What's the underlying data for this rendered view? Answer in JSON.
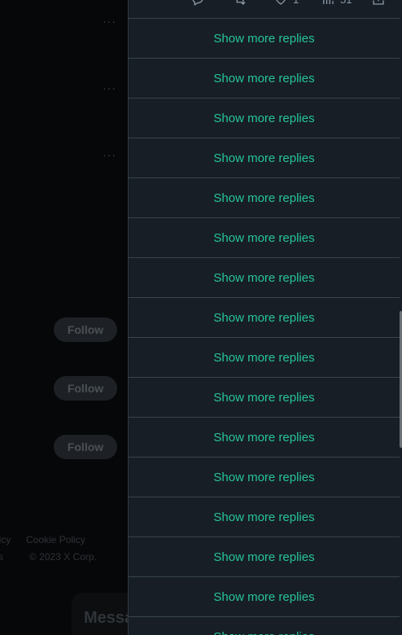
{
  "background": {
    "follow_label": "Follow",
    "footer_line1_a": "licy",
    "footer_line1_b": "Cookie Policy",
    "footer_line2_a": "s",
    "footer_line2_b": "© 2023 X Corp.",
    "messages_label": "Messages"
  },
  "actions": {
    "like_count": "1",
    "view_count": "51"
  },
  "replies": {
    "show_more_label": "Show more replies"
  },
  "colors": {
    "accent": "#27c49a",
    "panel_bg": "#171e26",
    "divider": "#38444d"
  }
}
